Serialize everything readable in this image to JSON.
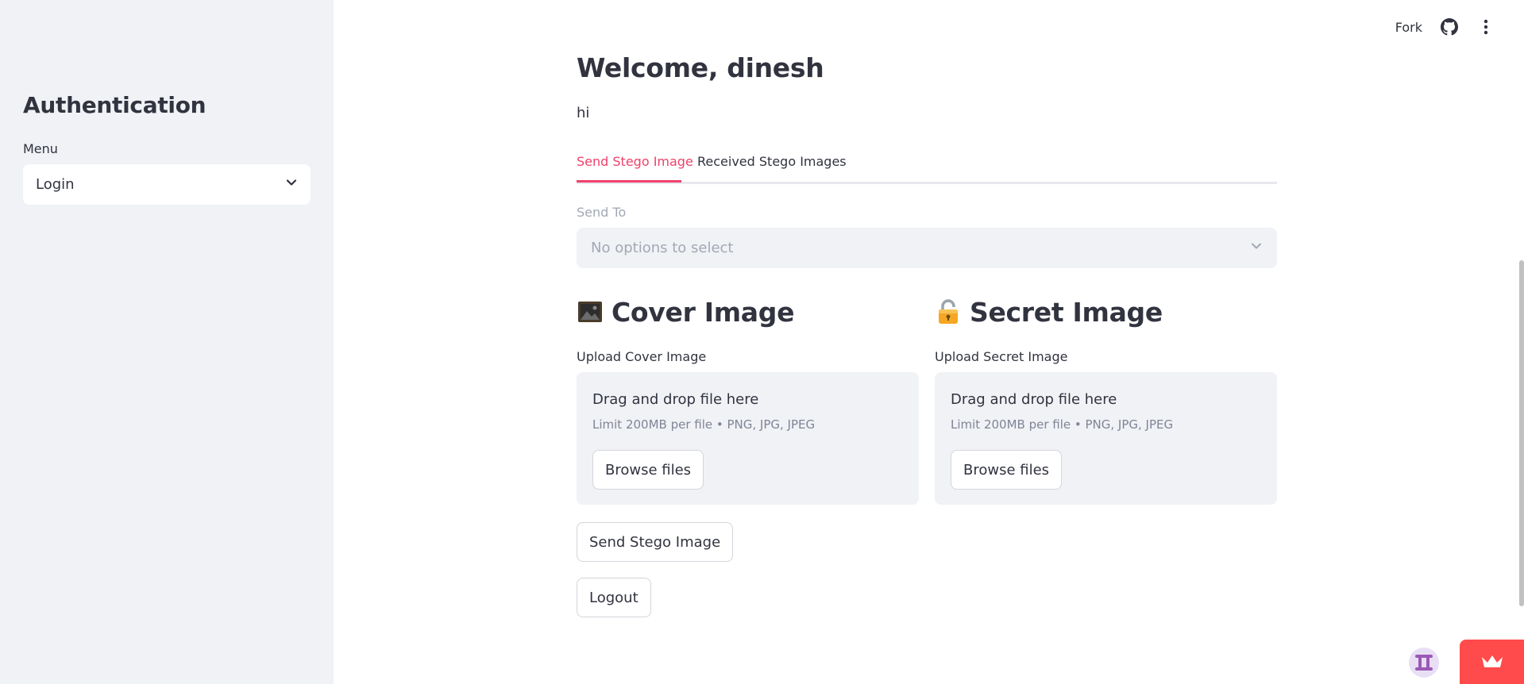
{
  "sidebar": {
    "title": "Authentication",
    "menu_label": "Menu",
    "menu_value": "Login"
  },
  "toolbar": {
    "fork_label": "Fork",
    "icons": [
      "github-icon",
      "more-vertical-icon"
    ]
  },
  "main": {
    "title": "Welcome, dinesh",
    "greeting": "hi",
    "tabs": [
      {
        "label": "Send Stego Image",
        "active": true
      },
      {
        "label": "Received Stego Images",
        "active": false
      }
    ],
    "send_to": {
      "label": "Send To",
      "placeholder": "No options to select"
    },
    "cover": {
      "heading": "Cover Image",
      "upload_label": "Upload Cover Image",
      "drop_title": "Drag and drop file here",
      "drop_sub": "Limit 200MB per file • PNG, JPG, JPEG",
      "browse_label": "Browse files"
    },
    "secret": {
      "heading": "Secret Image",
      "upload_label": "Upload Secret Image",
      "drop_title": "Drag and drop file here",
      "drop_sub": "Limit 200MB per file • PNG, JPG, JPEG",
      "browse_label": "Browse files"
    },
    "send_button": "Send Stego Image",
    "logout_button": "Logout"
  },
  "colors": {
    "accent": "#f0406b",
    "sidebar_bg": "#f0f2f6",
    "text": "#31333f",
    "muted": "#a3a8b4",
    "brand_red": "#ff4b4b"
  }
}
